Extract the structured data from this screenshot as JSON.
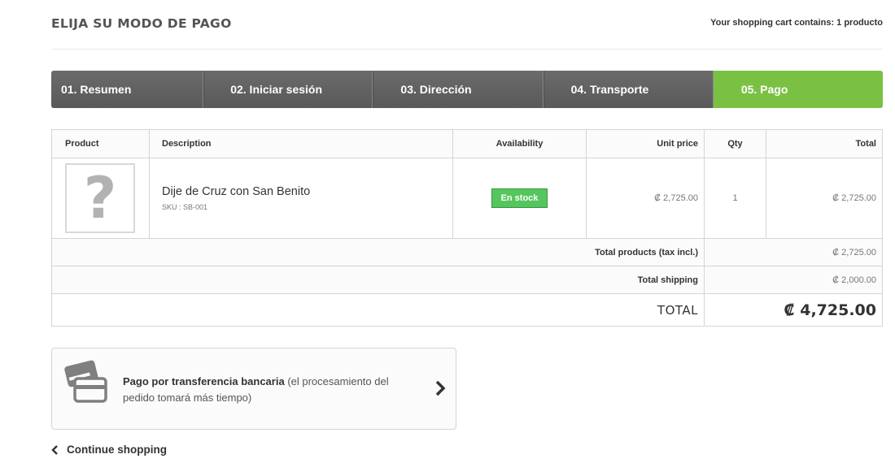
{
  "heading": {
    "title": "ELIJA SU MODO DE PAGO",
    "cart_summary": "Your shopping cart contains: 1 producto"
  },
  "steps": [
    {
      "label": "01. Resumen",
      "active": false
    },
    {
      "label": "02. Iniciar sesión",
      "active": false
    },
    {
      "label": "03. Dirección",
      "active": false
    },
    {
      "label": "04. Transporte",
      "active": false
    },
    {
      "label": "05. Pago",
      "active": true
    }
  ],
  "table": {
    "headers": {
      "product": "Product",
      "description": "Description",
      "availability": "Availability",
      "unit_price": "Unit price",
      "qty": "Qty",
      "total": "Total"
    },
    "items": [
      {
        "thumb_glyph": "?",
        "name": "Dije de Cruz con San Benito",
        "sku": "SKU : SB-001",
        "availability": "En stock",
        "unit_price": "₡ 2,725.00",
        "qty": "1",
        "total": "₡ 2,725.00"
      }
    ],
    "totals": {
      "products_label": "Total products (tax incl.)",
      "products_value": "₡ 2,725.00",
      "shipping_label": "Total shipping",
      "shipping_value": "₡ 2,000.00",
      "grand_label": "TOTAL",
      "grand_value": "₡ 4,725.00"
    }
  },
  "payment": {
    "icon": "credit-card-icon",
    "title": "Pago por transferencia bancaria",
    "subtitle": "(el procesamiento del pedido tomará más tiempo)"
  },
  "continue_label": "Continue shopping",
  "colors": {
    "active_step": "#7ac143",
    "step_bg": "#616161",
    "stock_badge": "#55c65e",
    "border": "#d6d4d4"
  }
}
